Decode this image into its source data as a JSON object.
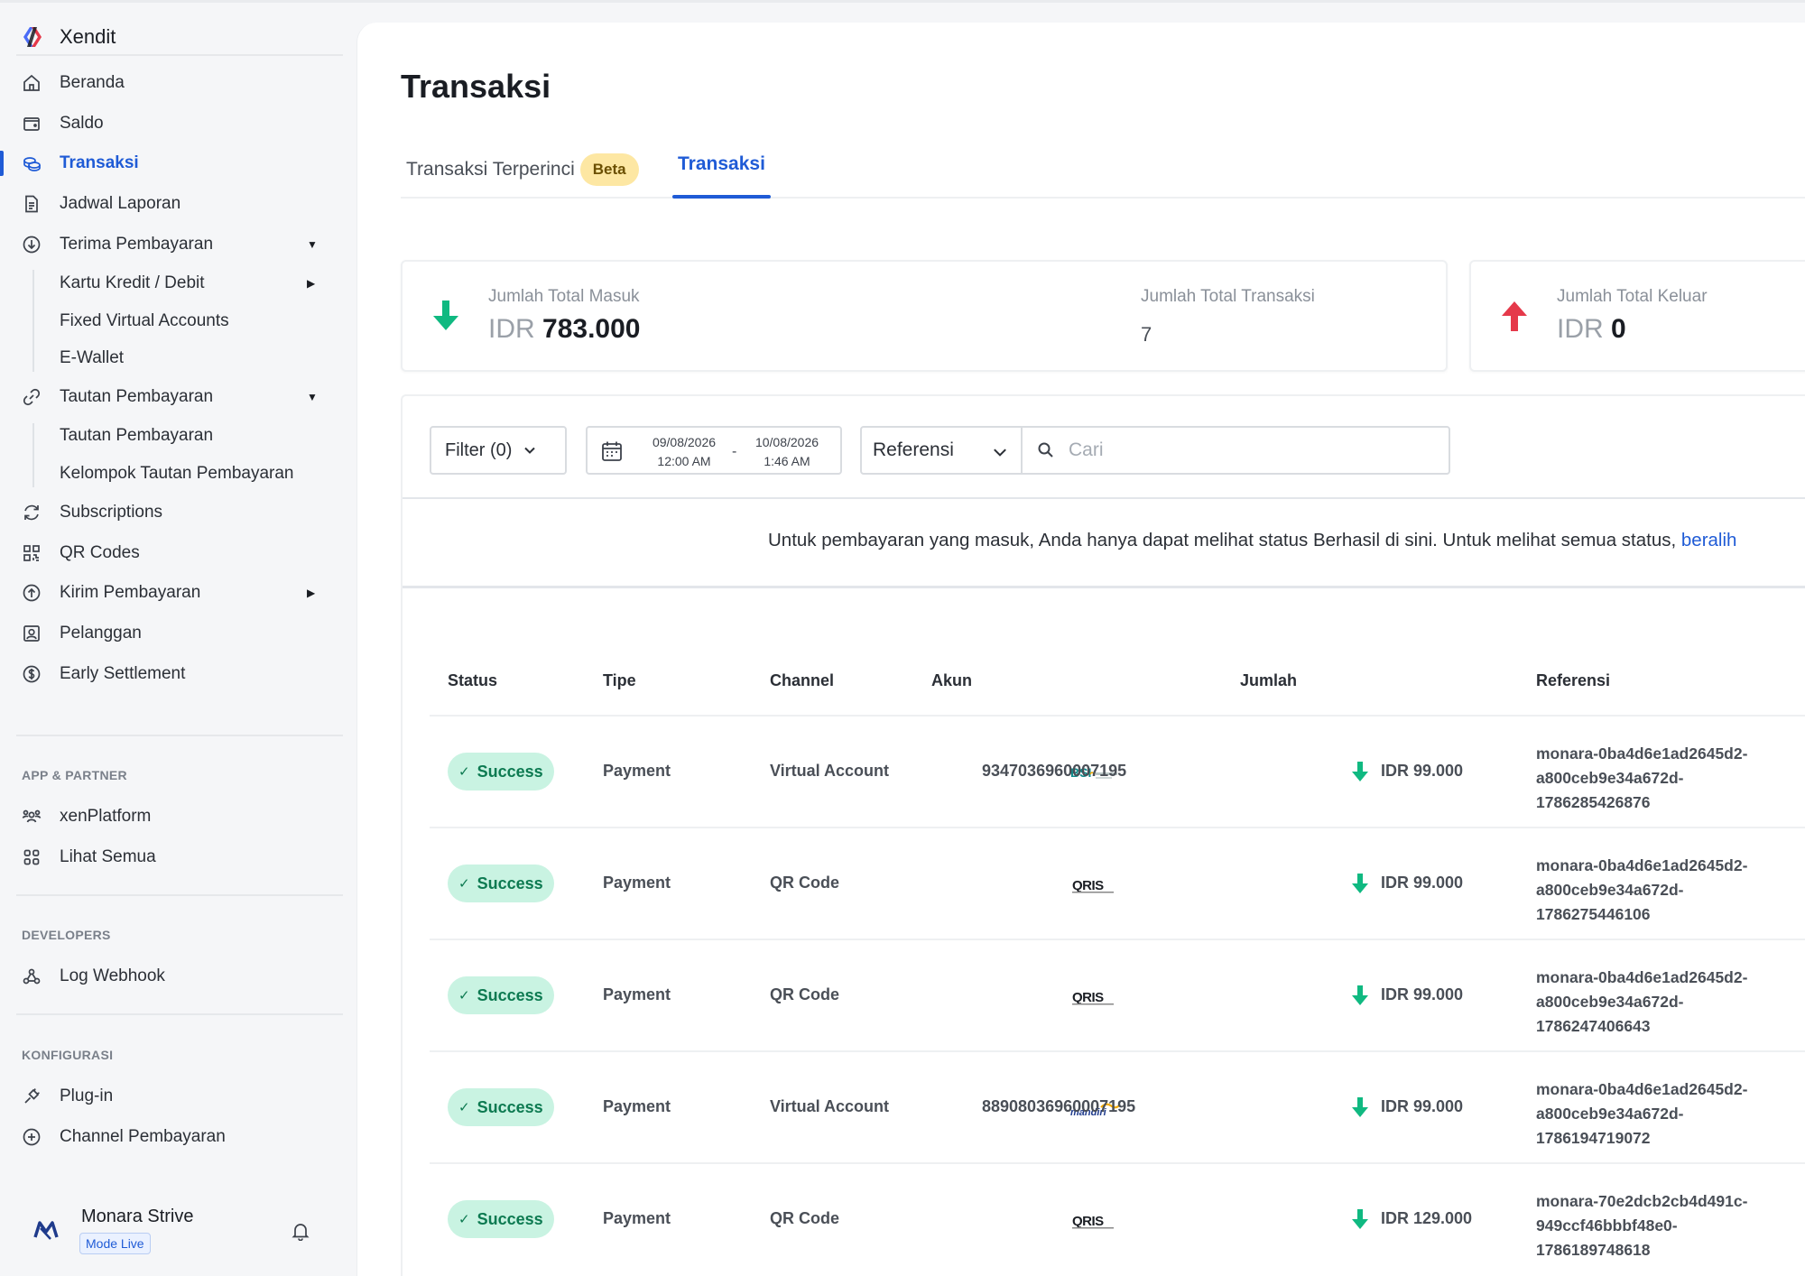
{
  "brand": {
    "name": "Xendit"
  },
  "sidebar": {
    "items": [
      {
        "label": "Beranda",
        "icon": "home-icon"
      },
      {
        "label": "Saldo",
        "icon": "wallet-icon"
      },
      {
        "label": "Transaksi",
        "icon": "coins-icon",
        "active": true
      },
      {
        "label": "Jadwal Laporan",
        "icon": "document-icon"
      },
      {
        "label": "Terima Pembayaran",
        "icon": "receive-icon"
      }
    ],
    "terima_sub": [
      "Kartu Kredit / Debit",
      "Fixed Virtual Accounts",
      "E-Wallet"
    ],
    "tautan": {
      "label": "Tautan Pembayaran"
    },
    "tautan_sub": [
      "Tautan Pembayaran",
      "Kelompok Tautan Pembayaran"
    ],
    "more": [
      {
        "label": "Subscriptions"
      },
      {
        "label": "QR Codes"
      },
      {
        "label": "Kirim Pembayaran"
      },
      {
        "label": "Pelanggan"
      },
      {
        "label": "Early Settlement"
      }
    ],
    "section_app": "APP & PARTNER",
    "app_items": [
      {
        "label": "xenPlatform"
      },
      {
        "label": "Lihat Semua"
      }
    ],
    "section_dev": "DEVELOPERS",
    "dev_items": [
      {
        "label": "Log Webhook"
      }
    ],
    "section_config": "KONFIGURASI",
    "config_items": [
      {
        "label": "Plug-in"
      },
      {
        "label": "Channel Pembayaran"
      }
    ]
  },
  "user": {
    "name": "Monara Strive",
    "mode": "Mode Live"
  },
  "page": {
    "title": "Transaksi"
  },
  "tabs": [
    {
      "label": "Transaksi Terperinci",
      "badge": "Beta"
    },
    {
      "label": "Transaksi",
      "active": true
    }
  ],
  "summary": {
    "masuk_label": "Jumlah Total Masuk",
    "masuk_currency": "IDR",
    "masuk_value": "783.000",
    "transaksi_label": "Jumlah Total Transaksi",
    "transaksi_value": "7",
    "keluar_label": "Jumlah Total Keluar",
    "keluar_currency": "IDR",
    "keluar_value": "0"
  },
  "filters": {
    "filter_label": "Filter (0)",
    "date_from": "09/08/2026",
    "time_from": "12:00 AM",
    "date_to": "10/08/2026",
    "time_to": "1:46 AM",
    "date_dash": "-",
    "ref_select": "Referensi",
    "search_placeholder": "Cari"
  },
  "notice": {
    "text": "Untuk pembayaran yang masuk, Anda hanya dapat melihat status Berhasil di sini. Untuk melihat semua status, ",
    "link": "beralih"
  },
  "table": {
    "headers": [
      "Status",
      "Tipe",
      "Channel",
      "Akun",
      "Jumlah",
      "Referensi"
    ],
    "rows": [
      {
        "status": "Success",
        "type": "Payment",
        "channel": "Virtual Account",
        "logo": "BSI",
        "account": "9347036960007195",
        "amount": "IDR 99.000",
        "ref1": "monara-0ba4d6e1ad2645d2-",
        "ref2": "a800ceb9e34a672d-",
        "ref3": "1786285426876"
      },
      {
        "status": "Success",
        "type": "Payment",
        "channel": "QR Code",
        "logo": "QRIS",
        "account": "",
        "amount": "IDR 99.000",
        "ref1": "monara-0ba4d6e1ad2645d2-",
        "ref2": "a800ceb9e34a672d-",
        "ref3": "1786275446106"
      },
      {
        "status": "Success",
        "type": "Payment",
        "channel": "QR Code",
        "logo": "QRIS",
        "account": "",
        "amount": "IDR 99.000",
        "ref1": "monara-0ba4d6e1ad2645d2-",
        "ref2": "a800ceb9e34a672d-",
        "ref3": "1786247406643"
      },
      {
        "status": "Success",
        "type": "Payment",
        "channel": "Virtual Account",
        "logo": "mandiri",
        "account": "88908036960007195",
        "amount": "IDR 99.000",
        "ref1": "monara-0ba4d6e1ad2645d2-",
        "ref2": "a800ceb9e34a672d-",
        "ref3": "1786194719072"
      },
      {
        "status": "Success",
        "type": "Payment",
        "channel": "QR Code",
        "logo": "QRIS",
        "account": "",
        "amount": "IDR 129.000",
        "ref1": "monara-70e2dcb2cb4d491c-",
        "ref2": "949ccf46bbbf48e0-",
        "ref3": "1786189748618"
      }
    ]
  },
  "colors": {
    "accent": "#1f5bd6",
    "success_bg": "#c9f3e2",
    "success_text": "#0d7a51",
    "in_arrow": "#10b981",
    "out_arrow": "#e5394a",
    "beta_bg": "#fde7a3"
  }
}
